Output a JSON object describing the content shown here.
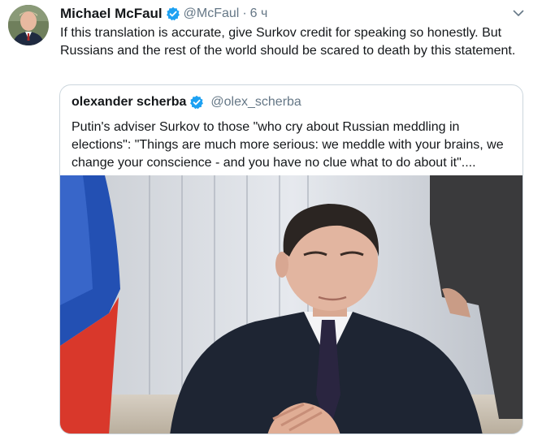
{
  "tweet": {
    "author_name": "Michael McFaul",
    "handle": "@McFaul",
    "separator": "·",
    "time": "6 ч",
    "text": "If this translation is accurate, give Surkov credit for speaking so honestly. But Russians and the rest of the world should be scared to death by this statement."
  },
  "quoted_tweet": {
    "author_name": "olexander scherba",
    "handle": "@olex_scherba",
    "text": "Putin's adviser Surkov to those \"who cry about Russian meddling in elections\": \"Things are much more serious: we meddle with your brains, we change your conscience - and you have no clue what to do about it\"...."
  },
  "colors": {
    "verified": "#1da1f2",
    "secondary_text": "#657786",
    "border": "#ccd6dd"
  }
}
